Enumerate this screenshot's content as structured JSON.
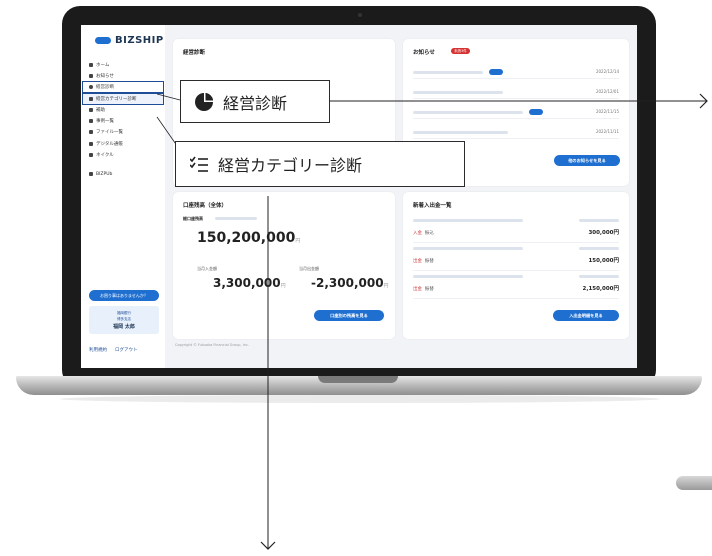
{
  "app": {
    "logo_text": "BIZSHIP",
    "brand_color": "#1f6fd1"
  },
  "sidebar": {
    "items": [
      {
        "label": "ホーム",
        "icon": "home-icon"
      },
      {
        "label": "お知らせ",
        "icon": "mail-icon"
      },
      {
        "label": "経営診断",
        "icon": "pie-chart-icon"
      },
      {
        "label": "経営カテゴリー診断",
        "icon": "checklist-icon"
      },
      {
        "label": "補助",
        "icon": "lightbulb-icon"
      },
      {
        "label": "事例一覧",
        "icon": "list-icon"
      },
      {
        "label": "ファイル一覧",
        "icon": "folder-icon"
      },
      {
        "label": "デジタル通帳",
        "icon": "book-icon"
      },
      {
        "label": "ネイクル",
        "icon": "link-icon"
      },
      {
        "label": "BIZPUb",
        "icon": "external-icon"
      }
    ],
    "help_button": "お困り事はありませんか？",
    "contact_bank": "福岡銀行",
    "contact_branch": "博多支店",
    "contact_name": "福岡 太郎",
    "footer_terms": "利用規約",
    "footer_logout": "ログアウト"
  },
  "main": {
    "diagnosis_card": {
      "title": "経営診断"
    },
    "news_card": {
      "title": "お知らせ",
      "badge": "未読3件",
      "dates": [
        "2022/12/14",
        "2022/12/01",
        "2022/11/15",
        "2022/11/11"
      ],
      "more_button": "他のお知らせを見る"
    },
    "balance_card": {
      "title": "口座残高（全体）",
      "total_label": "総口座残高",
      "total": "150,200,000",
      "in_label": "当月入金額",
      "in_value": "3,300,000",
      "out_label": "当月出金額",
      "out_value": "-2,300,000",
      "yen": "円",
      "detail_button": "口座別の残高を見る"
    },
    "tx_card": {
      "title": "新着入出金一覧",
      "rows": [
        {
          "kind": "入金",
          "memo": "振込",
          "amount": "300,000円"
        },
        {
          "kind": "出金",
          "memo": "振替",
          "amount": "150,000円"
        },
        {
          "kind": "出金",
          "memo": "振替",
          "amount": "2,150,000円"
        }
      ],
      "detail_button": "入出金明細を見る"
    },
    "copyright": "Copyright © Fukuoka Financial Group, Inc."
  },
  "callouts": {
    "diagnosis": {
      "label": "経営診断",
      "icon": "pie-chart-icon"
    },
    "category": {
      "label": "経営カテゴリー診断",
      "icon": "checklist-icon"
    }
  }
}
